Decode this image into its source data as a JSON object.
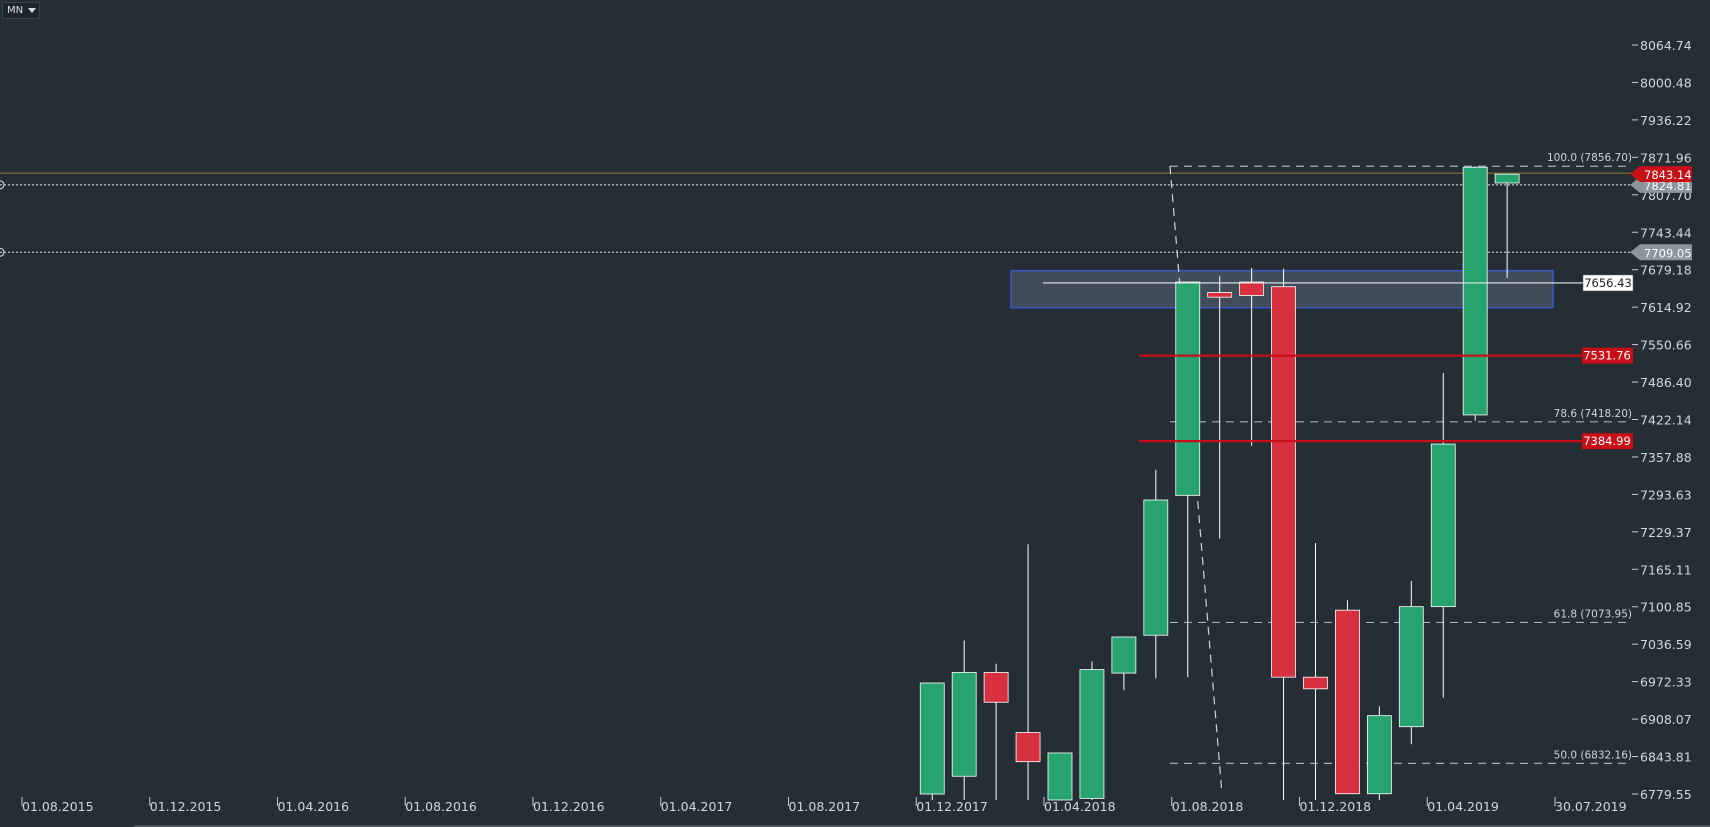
{
  "toolbar": {
    "timeframe": "MN"
  },
  "colors": {
    "background": "#252e35",
    "up": "#26a36e",
    "down": "#d7303f",
    "wick": "#ffffff",
    "red_level": "#c70f18",
    "zone_border": "#3c56c8",
    "zone_fill": "#4a5866",
    "fib_line": "#a8b0b6",
    "price_line": "#8f7a34"
  },
  "chart_data": {
    "type": "candlestick",
    "title": "",
    "ylim": [
      6779.55,
      8064.74
    ],
    "y_ticks": [
      "8064.74",
      "8000.48",
      "7936.22",
      "7871.96",
      "7807.70",
      "7743.44",
      "7679.18",
      "7614.92",
      "7550.66",
      "7486.40",
      "7422.14",
      "7357.88",
      "7293.63",
      "7229.37",
      "7165.11",
      "7100.85",
      "7036.59",
      "6972.33",
      "6908.07",
      "6843.81",
      "6779.55"
    ],
    "x_ticks": [
      "01.08.2015",
      "01.12.2015",
      "01.04.2016",
      "01.08.2016",
      "01.12.2016",
      "01.04.2017",
      "01.08.2017",
      "01.12.2017",
      "01.04.2018",
      "01.08.2018",
      "01.12.2018",
      "01.04.2019",
      "30.07.2019"
    ],
    "candles": [
      {
        "date": "2017-12",
        "open": 6779.55,
        "high": 6820,
        "low": 6740,
        "close": 6970
      },
      {
        "date": "2018-01",
        "open": 6810,
        "high": 7043,
        "low": 6760,
        "close": 6988
      },
      {
        "date": "2018-02",
        "open": 6988,
        "high": 7003,
        "low": 6720,
        "close": 6937
      },
      {
        "date": "2018-03",
        "open": 6885,
        "high": 7208,
        "low": 6760,
        "close": 6835
      },
      {
        "date": "2018-04",
        "open": 6760,
        "high": 6820,
        "low": 6700,
        "close": 6850
      },
      {
        "date": "2018-05",
        "open": 6772,
        "high": 7007,
        "low": 6720,
        "close": 6993
      },
      {
        "date": "2018-06",
        "open": 6987,
        "high": 7050,
        "low": 6958,
        "close": 7049
      },
      {
        "date": "2018-07",
        "open": 7052,
        "high": 7336,
        "low": 6978,
        "close": 7284
      },
      {
        "date": "2018-08",
        "open": 7292,
        "high": 7502,
        "low": 6980,
        "close": 7658
      },
      {
        "date": "2018-09",
        "open": 7640,
        "high": 7668,
        "low": 7218,
        "close": 7632
      },
      {
        "date": "2018-10",
        "open": 7658,
        "high": 7682,
        "low": 7377,
        "close": 7635
      },
      {
        "date": "2018-11",
        "open": 7650,
        "high": 7681,
        "low": 6752,
        "close": 6980
      },
      {
        "date": "2018-12",
        "open": 6980,
        "high": 7210,
        "low": 6740,
        "close": 6960
      },
      {
        "date": "2019-01",
        "open": 7095,
        "high": 7112,
        "low": 6780,
        "close": 6780
      },
      {
        "date": "2019-02",
        "open": 6780,
        "high": 6930,
        "low": 6730,
        "close": 6914
      },
      {
        "date": "2019-03",
        "open": 6895,
        "high": 7145,
        "low": 6865,
        "close": 7101
      },
      {
        "date": "2019-04",
        "open": 7101,
        "high": 7502,
        "low": 6945,
        "close": 7380
      },
      {
        "date": "2019-05",
        "open": 7430,
        "high": 7856.7,
        "low": 7420,
        "close": 7855
      },
      {
        "date": "2019-06",
        "open": 7828,
        "high": 7843.14,
        "low": 7665,
        "close": 7843.14
      }
    ],
    "fibonacci": [
      {
        "label": "100.0 (7856.70)",
        "value": 7856.7
      },
      {
        "label": "78.6 (7418.20)",
        "value": 7418.2
      },
      {
        "label": "61.8 (7073.95)",
        "value": 7073.95
      },
      {
        "label": "50.0 (6832.16)",
        "value": 6832.16
      }
    ],
    "horizontal_lines": [
      {
        "label": "7531.76",
        "value": 7531.76,
        "style": "solid-red"
      },
      {
        "label": "7384.99",
        "value": 7384.99,
        "style": "solid-red"
      },
      {
        "label": "7824.81",
        "value": 7824.81,
        "style": "dotted-white"
      },
      {
        "label": "7709.05",
        "value": 7709.05,
        "style": "dotted-white"
      }
    ],
    "zone": {
      "top": 7679.18,
      "bottom": 7626.0,
      "from": "2018-06",
      "to": "2019-10"
    },
    "zone_line": {
      "label": "7656.43",
      "value": 7656.43
    },
    "last_price": {
      "label": "7843.14",
      "value": 7843.14
    }
  }
}
